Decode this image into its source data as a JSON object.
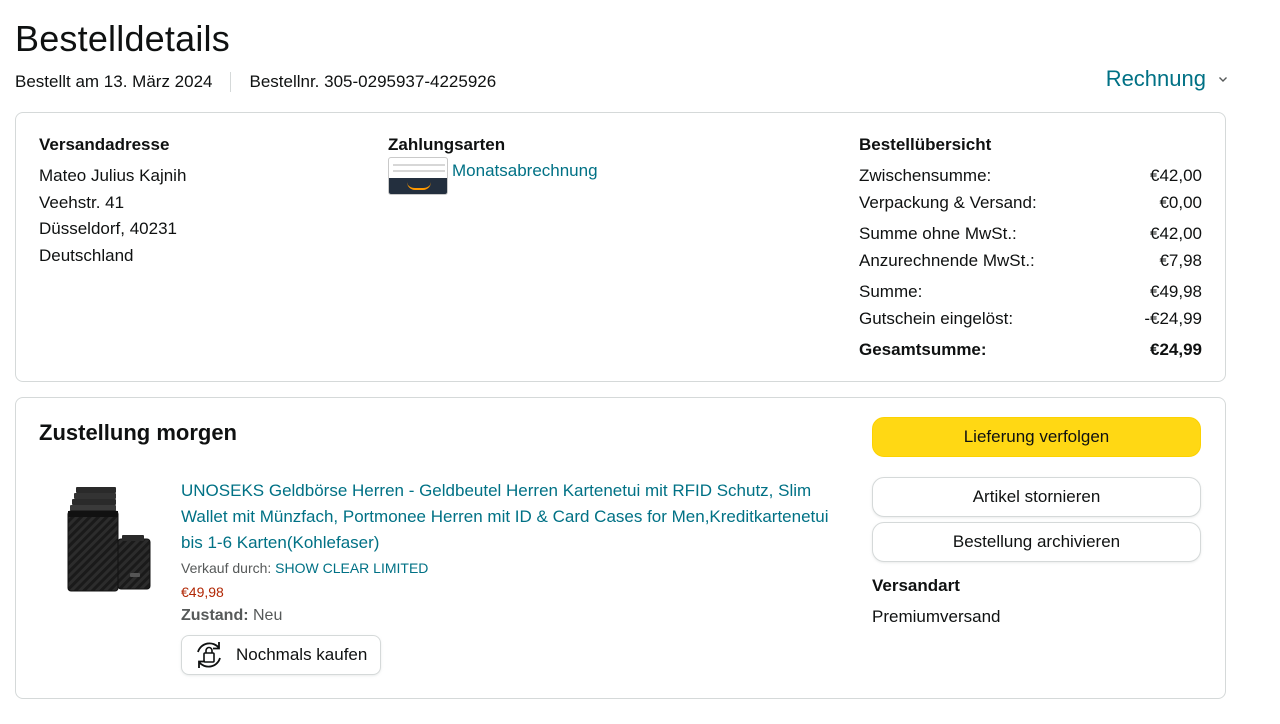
{
  "header": {
    "title": "Bestelldetails",
    "ordered_on": "Bestellt am 13. März 2024",
    "order_number": "Bestellnr. 305-0295937-4225926",
    "invoice_label": "Rechnung"
  },
  "shipping_address": {
    "title": "Versandadresse",
    "lines": [
      "Mateo Julius Kajnih",
      "Veehstr. 41",
      "Düsseldorf, 40231",
      "Deutschland"
    ]
  },
  "payment": {
    "title": "Zahlungsarten",
    "method": "Monatsabrechnung"
  },
  "order_summary": {
    "title": "Bestellübersicht",
    "rows": [
      {
        "label": "Zwischensumme:",
        "value": "€42,00"
      },
      {
        "label": "Verpackung & Versand:",
        "value": "€0,00"
      },
      {
        "label": "Summe ohne MwSt.:",
        "value": "€42,00"
      },
      {
        "label": "Anzurechnende MwSt.:",
        "value": "€7,98"
      },
      {
        "label": "Summe:",
        "value": "€49,98"
      },
      {
        "label": "Gutschein eingelöst:",
        "value": "-€24,99"
      },
      {
        "label": "Gesamtsumme:",
        "value": "€24,99"
      }
    ]
  },
  "delivery": {
    "title": "Zustellung morgen",
    "product": {
      "title": "UNOSEKS Geldbörse Herren - Geldbeutel Herren Kartenetui mit RFID Schutz, Slim Wallet mit Münzfach, Portmonee Herren mit ID & Card Cases for Men,Kreditkartenetui bis 1-6 Karten(Kohlefaser)",
      "seller_prefix": "Verkauf durch:",
      "seller_name": "SHOW CLEAR LIMITED",
      "price": "€49,98",
      "condition_label": "Zustand:",
      "condition_value": "Neu",
      "buy_again_label": "Nochmals kaufen"
    },
    "actions": {
      "track": "Lieferung verfolgen",
      "cancel": "Artikel stornieren",
      "archive": "Bestellung archivieren"
    },
    "shipping_method_title": "Versandart",
    "shipping_method_value": "Premiumversand"
  },
  "colors": {
    "link": "#007185",
    "primary_button": "#ffd814",
    "price": "#b12704",
    "border": "#d5d9d9"
  },
  "icons": [
    "chevron-down-icon",
    "amazon-card-icon",
    "buy-again-icon",
    "wallet-product-image"
  ]
}
